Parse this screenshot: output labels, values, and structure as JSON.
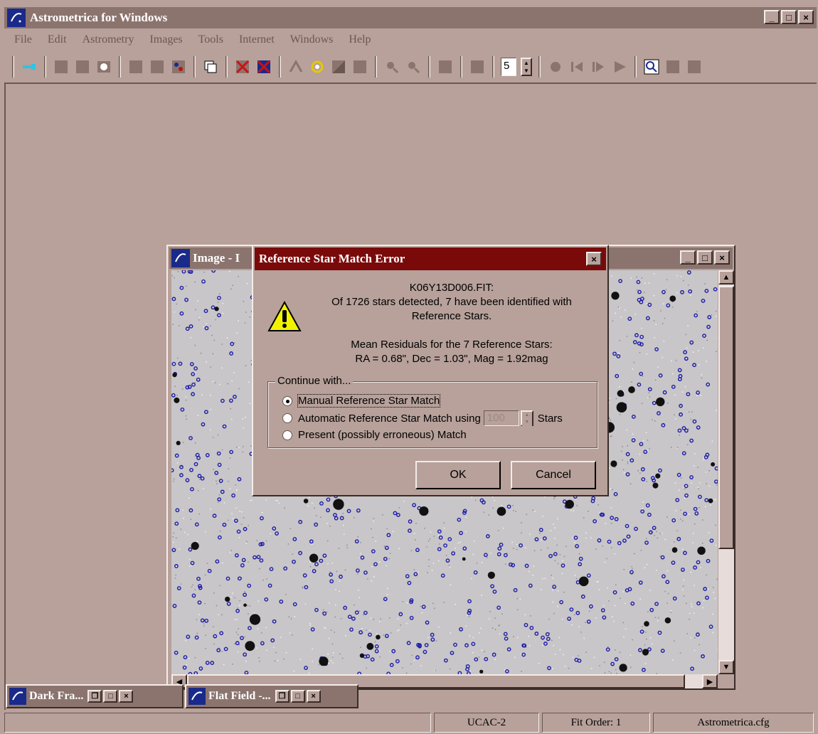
{
  "main_window": {
    "title": "Astrometrica for Windows",
    "controls": [
      "_",
      "□",
      "×"
    ]
  },
  "menu": [
    "File",
    "Edit",
    "Astrometry",
    "Images",
    "Tools",
    "Internet",
    "Windows",
    "Help"
  ],
  "toolbar": {
    "spin_value": "5"
  },
  "image_window": {
    "title": "Image - I"
  },
  "dialog": {
    "title": "Reference Star Match Error",
    "filename": "K06Y13D006.FIT:",
    "line1": "Of 1726 stars detected, 7 have been identified with",
    "line2": "Reference Stars.",
    "line3": "Mean Residuals for the 7 Reference Stars:",
    "line4": "RA = 0.68\",  Dec = 1.03\",  Mag = 1.92mag",
    "group_label": "Continue with...",
    "options": [
      "Manual Reference Star Match",
      "Automatic Reference Star Match using",
      "Present (possibly erroneous) Match"
    ],
    "stars_value": "100",
    "stars_unit": "Stars",
    "ok_label": "OK",
    "cancel_label": "Cancel"
  },
  "minimized": [
    {
      "title": "Dark Fra..."
    },
    {
      "title": "Flat Field -..."
    }
  ],
  "status": [
    "UCAC-2",
    "Fit Order: 1",
    "Astrometrica.cfg"
  ]
}
